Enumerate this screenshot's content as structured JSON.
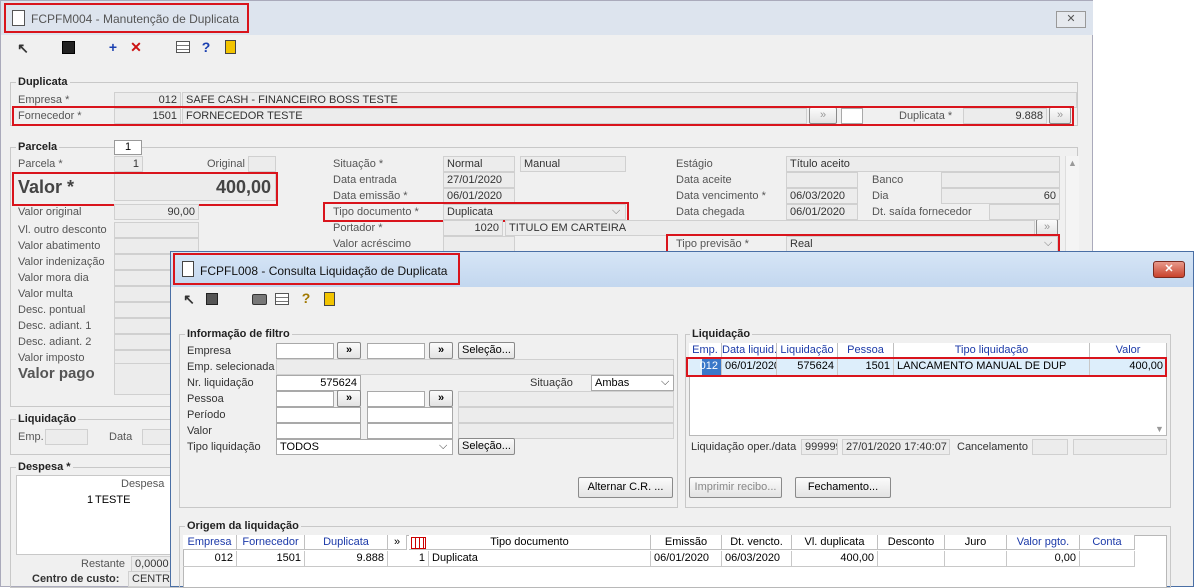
{
  "main": {
    "title": "FCPFM004 - Manutenção de Duplicata",
    "duplicata": {
      "section": "Duplicata",
      "empresa_label": "Empresa *",
      "empresa_code": "012",
      "empresa_name": "SAFE CASH - FINANCEIRO BOSS TESTE",
      "fornecedor_label": "Fornecedor *",
      "fornecedor_code": "1501",
      "fornecedor_name": "FORNECEDOR TESTE",
      "duplicata_label": "Duplicata *",
      "duplicata_value": "9.888",
      "arrow": "»"
    },
    "parcela": {
      "section": "Parcela",
      "tab": "1",
      "parcela_label": "Parcela *",
      "parcela_value": "1",
      "original_label": "Original",
      "valor_label": "Valor *",
      "valor_value": "400,00",
      "valor_original_label": "Valor original",
      "valor_original_value": "90,00",
      "labels": [
        "Vl. outro desconto",
        "Valor abatimento",
        "Valor indenização",
        "Valor mora dia",
        "Valor multa",
        "Desc. pontual",
        "Desc. adiant. 1",
        "Desc. adiant. 2",
        "Valor imposto"
      ],
      "valor_pago_label": "Valor pago"
    },
    "center": {
      "situacao_label": "Situação *",
      "situacao_value": "Normal",
      "situacao_value2": "Manual",
      "data_entrada_label": "Data entrada",
      "data_entrada_value": "27/01/2020",
      "data_emissao_label": "Data emissão *",
      "data_emissao_value": "06/01/2020",
      "tipo_documento_label": "Tipo documento *",
      "tipo_documento_value": "Duplicata",
      "portador_label": "Portador *",
      "portador_code": "1020",
      "portador_name": "TITULO EM CARTEIRA",
      "valor_acrescimo_label": "Valor acréscimo"
    },
    "right": {
      "estagio_label": "Estágio",
      "estagio_value": "Título aceito",
      "data_aceite_label": "Data aceite",
      "banco_label": "Banco",
      "data_vencimento_label": "Data vencimento *",
      "data_vencimento_value": "06/03/2020",
      "dia_label": "Dia",
      "dia_value": "60",
      "data_chegada_label": "Data chegada",
      "data_chegada_value": "06/01/2020",
      "dt_saida_label": "Dt. saída fornecedor",
      "tipo_previsao_label": "Tipo previsão *",
      "tipo_previsao_value": "Real"
    },
    "liquidacao": {
      "section": "Liquidação",
      "emp_label": "Emp.",
      "data_label": "Data"
    },
    "despesa": {
      "section": "Despesa *",
      "col": "Despesa",
      "row_num": "1",
      "row_name": "TESTE",
      "restante_label": "Restante",
      "restante_value": "0,0000",
      "centro_label": "Centro de custo:",
      "centro_value": "CENTRO"
    }
  },
  "dialog": {
    "title": "FCPFL008 - Consulta Liquidação de Duplicata",
    "close_label": "✕",
    "filtro": {
      "section": "Informação de filtro",
      "empresa_label": "Empresa",
      "emp_selecionada_label": "Emp. selecionada",
      "nr_liquidacao_label": "Nr. liquidação",
      "nr_liquidacao_value": "575624",
      "situacao_label": "Situação",
      "situacao_value": "Ambas",
      "pessoa_label": "Pessoa",
      "periodo_label": "Período",
      "valor_label": "Valor",
      "tipo_liquidacao_label": "Tipo liquidação",
      "tipo_liquidacao_value": "TODOS",
      "selecao_label": "Seleção...",
      "arrow": "»",
      "alternar_label": "Alternar C.R. ..."
    },
    "liquidacao": {
      "section": "Liquidação",
      "headers": [
        "Emp.",
        "Data liquid.",
        "Liquidação",
        "Pessoa",
        "Tipo liquidação",
        "Valor"
      ],
      "row": [
        "012",
        "06/01/2020",
        "575624",
        "1501",
        "LANCAMENTO MANUAL DE DUP",
        "400,00"
      ],
      "oper_label": "Liquidação oper./data",
      "oper_value": "999999",
      "oper_date": "27/01/2020 17:40:07",
      "cancelamento_label": "Cancelamento",
      "imprimir_label": "Imprimir recibo...",
      "fechamento_label": "Fechamento..."
    },
    "origem": {
      "section": "Origem da liquidação",
      "headers": [
        "Empresa",
        "Fornecedor",
        "Duplicata",
        "»",
        "",
        "Tipo documento",
        "Emissão",
        "Dt. vencto.",
        "Vl. duplicata",
        "Desconto",
        "Juro",
        "Valor pgto.",
        "Conta"
      ],
      "row": [
        "012",
        "1501",
        "9.888",
        "",
        "1",
        "Duplicata",
        "06/01/2020",
        "06/03/2020",
        "400,00",
        "",
        "",
        "0,00",
        ""
      ]
    }
  }
}
